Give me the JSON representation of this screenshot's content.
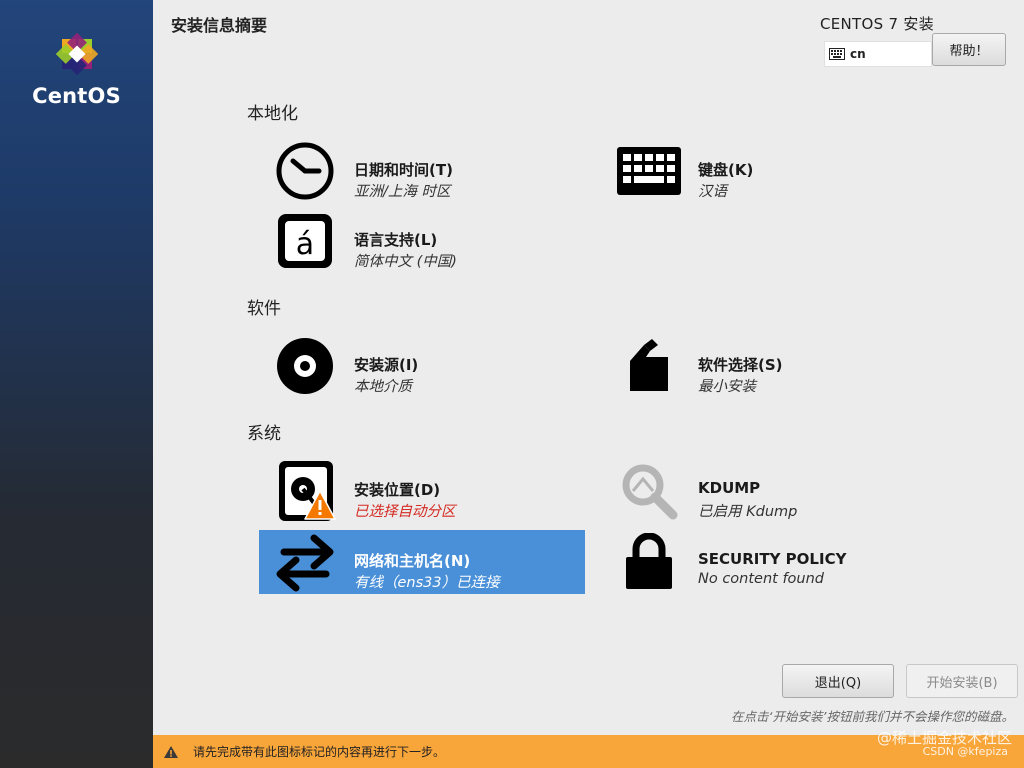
{
  "sidebar": {
    "logo_text": "CentOS"
  },
  "header": {
    "page_title": "安装信息摘要",
    "install_title": "CENTOS 7 安装",
    "keyboard_layout": "cn",
    "help_label": "帮助！"
  },
  "sections": {
    "localization": "本地化",
    "software": "软件",
    "system": "系统"
  },
  "spokes": {
    "datetime": {
      "label": "日期和时间(T)",
      "status": "亚洲/上海 时区"
    },
    "keyboard": {
      "label": "键盘(K)",
      "status": "汉语"
    },
    "language": {
      "label": "语言支持(L)",
      "status": "简体中文 (中国)"
    },
    "source": {
      "label": "安装源(I)",
      "status": "本地介质"
    },
    "software": {
      "label": "软件选择(S)",
      "status": "最小安装"
    },
    "destination": {
      "label": "安装位置(D)",
      "status": "已选择自动分区"
    },
    "kdump": {
      "label": "KDUMP",
      "status": "已启用 Kdump"
    },
    "network": {
      "label": "网络和主机名(N)",
      "status": "有线（ens33）已连接"
    },
    "security": {
      "label": "SECURITY POLICY",
      "status": "No content found"
    }
  },
  "footer": {
    "quit_label": "退出(Q)",
    "begin_label": "开始安装(B)",
    "disclaimer": "在点击‘开始安装’按钮前我们并不会操作您的磁盘。",
    "warning_text": "请先完成带有此图标标记的内容再进行下一步。",
    "watermark": "@稀土掘金技术社区",
    "watermark2": "CSDN @kfepiza"
  },
  "colors": {
    "selected": "#4a90d9",
    "warning_bar": "#f8a53a",
    "warning_text": "#d42b22"
  },
  "icons": {
    "clock": "clock-icon",
    "keyboard": "keyboard-icon",
    "language": "language-icon",
    "disc": "disc-icon",
    "package": "package-icon",
    "harddisk": "harddisk-icon",
    "warning": "warning-icon",
    "search": "search-icon",
    "network": "network-arrows-icon",
    "lock": "lock-icon"
  }
}
